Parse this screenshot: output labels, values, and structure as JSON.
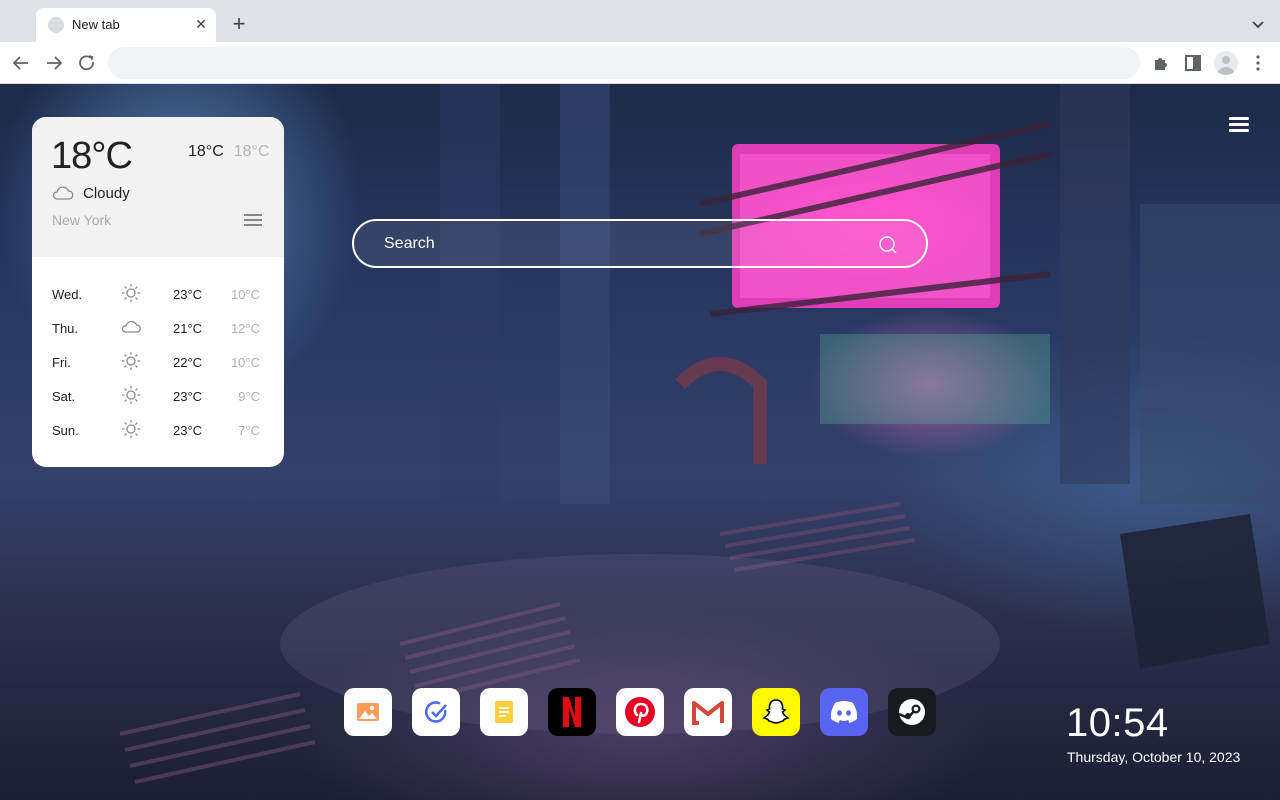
{
  "browser": {
    "tab_title": "New tab",
    "close_tab_icon": "close-icon",
    "new_tab_icon": "plus-icon",
    "tab_search_icon": "chevron-down-icon",
    "nav_icons": [
      "back-arrow-icon",
      "forward-arrow-icon",
      "reload-icon"
    ],
    "omnibox_value": "",
    "toolbar_icons": [
      "extensions-icon",
      "side-panel-icon",
      "profile-avatar",
      "more-vert-icon"
    ]
  },
  "weather": {
    "temperature": "18°C",
    "high": "18°C",
    "low": "18°C",
    "condition": "Cloudy",
    "condition_icon": "cloud-icon",
    "city": "New York",
    "forecast": [
      {
        "day": "Wed.",
        "icon": "sun-icon",
        "high": "23°C",
        "low": "10°C"
      },
      {
        "day": "Thu.",
        "icon": "cloud-icon",
        "high": "21°C",
        "low": "12°C"
      },
      {
        "day": "Fri.",
        "icon": "sun-icon",
        "high": "22°C",
        "low": "10°C"
      },
      {
        "day": "Sat.",
        "icon": "sun-icon",
        "high": "23°C",
        "low": "9°C"
      },
      {
        "day": "Sun.",
        "icon": "sun-icon",
        "high": "23°C",
        "low": "7°C"
      }
    ]
  },
  "search": {
    "placeholder": "Search"
  },
  "dock": [
    {
      "name": "photos",
      "icon": "photo-icon"
    },
    {
      "name": "tasks",
      "icon": "check-circle-icon"
    },
    {
      "name": "notes",
      "icon": "note-icon"
    },
    {
      "name": "netflix",
      "icon": "netflix-icon"
    },
    {
      "name": "pinterest",
      "icon": "pinterest-icon"
    },
    {
      "name": "gmail",
      "icon": "gmail-icon"
    },
    {
      "name": "snapchat",
      "icon": "snapchat-icon"
    },
    {
      "name": "discord",
      "icon": "discord-icon"
    },
    {
      "name": "steam",
      "icon": "steam-icon"
    }
  ],
  "clock": {
    "time": "10:54",
    "date": "Thursday, October 10, 2023"
  },
  "colors": {
    "neon_pink": "#ff3cc8",
    "netflix_red": "#e50914",
    "pinterest_red": "#e60023",
    "snapchat_yellow": "#fffc00",
    "discord_blurple": "#5865f2",
    "steam_dark": "#171a21"
  }
}
